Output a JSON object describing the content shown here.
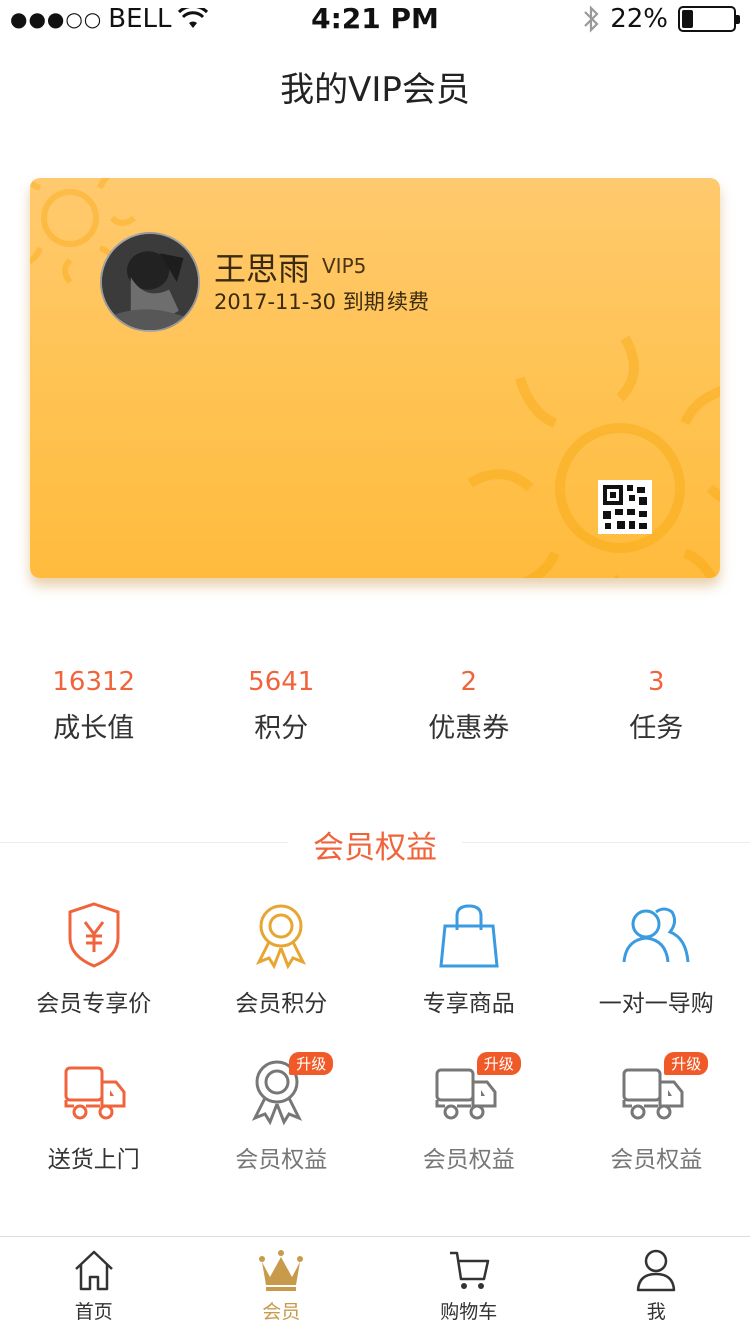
{
  "status_bar": {
    "signal": "●●●○○",
    "carrier": "BELL",
    "time": "4:21 PM",
    "battery": "22%",
    "battery_level": 0.22
  },
  "page_title": "我的VIP会员",
  "card": {
    "name": "王思雨",
    "level": "VIP5",
    "expire": "2017-11-30 到期",
    "renew": "续费"
  },
  "stats": [
    {
      "value": "16312",
      "label": "成长值"
    },
    {
      "value": "5641",
      "label": "积分"
    },
    {
      "value": "2",
      "label": "优惠券"
    },
    {
      "value": "3",
      "label": "任务"
    }
  ],
  "section_title": "会员权益",
  "benefits": [
    {
      "label": "会员专享价",
      "icon": "shield-yen-icon"
    },
    {
      "label": "会员积分",
      "icon": "award-ribbon-icon"
    },
    {
      "label": "专享商品",
      "icon": "shopping-bag-icon"
    },
    {
      "label": "一对一导购",
      "icon": "users-icon"
    },
    {
      "label": "送货上门",
      "icon": "delivery-truck-icon"
    },
    {
      "label": "会员权益",
      "icon": "award-ribbon-icon",
      "badge": "升级"
    },
    {
      "label": "会员权益",
      "icon": "delivery-truck-icon",
      "badge": "升级"
    },
    {
      "label": "会员权益",
      "icon": "delivery-truck-icon",
      "badge": "升级"
    }
  ],
  "tabs": [
    {
      "label": "首页",
      "icon": "home-icon"
    },
    {
      "label": "会员",
      "icon": "crown-icon",
      "active": true
    },
    {
      "label": "购物车",
      "icon": "cart-icon"
    },
    {
      "label": "我",
      "icon": "user-icon"
    }
  ],
  "colors": {
    "accent": "#f0643c",
    "card": "#ffc24f",
    "active_tab": "#c89a4b"
  }
}
